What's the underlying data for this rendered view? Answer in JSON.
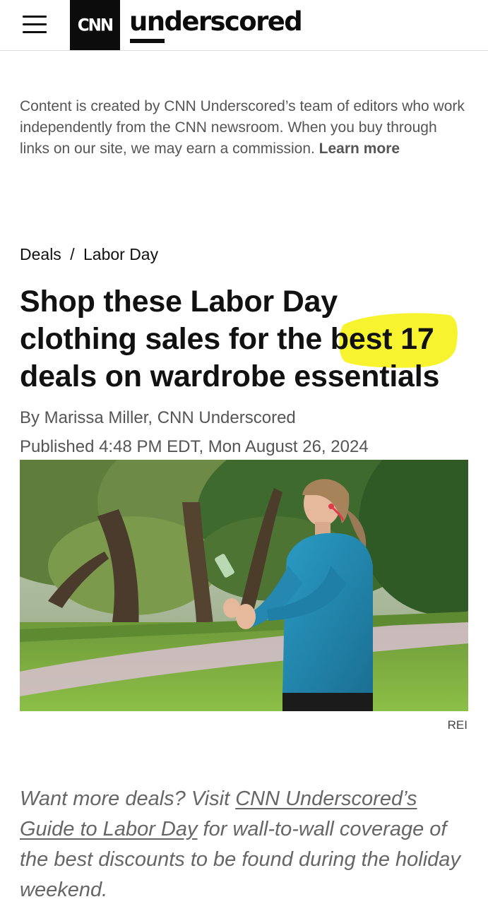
{
  "header": {
    "logo_text": "CNN",
    "brand": "underscored",
    "colors": {
      "logo_bg": "#0c0c0c",
      "highlight": "#f6f20a"
    }
  },
  "disclaimer": {
    "text": "Content is created by CNN Underscored’s team of editors who work independently from the CNN newsroom. When you buy through links on our site, we may earn a commission.",
    "link": "Learn more"
  },
  "breadcrumb": {
    "section": "Deals",
    "separator": "/",
    "subsection": "Labor Day"
  },
  "article": {
    "headline_line1": "Shop these Labor Day",
    "headline_line2": "clothing sales for the best 17",
    "headline_line3": "deals on wardrobe essentials",
    "byline": "By Marissa Miller, CNN Underscored",
    "published": "Published 4:48 PM EDT, Mon August 26, 2024",
    "image_credit": "REI"
  },
  "blurb": {
    "prefix": "Want more deals? Visit ",
    "link": "CNN Underscored’s Guide to Labor Day",
    "suffix": " for wall-to-wall coverage of the best discounts to be found during the holiday weekend."
  }
}
